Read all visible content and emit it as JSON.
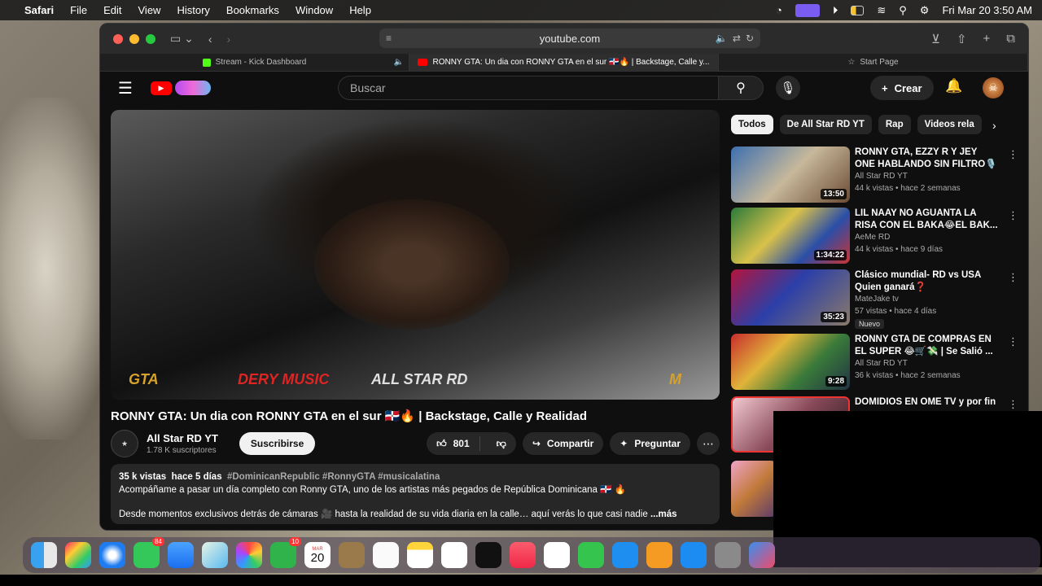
{
  "menubar": {
    "app": "Safari",
    "items": [
      "File",
      "Edit",
      "View",
      "History",
      "Bookmarks",
      "Window",
      "Help"
    ],
    "clock": "Fri Mar 20  3:50 AM"
  },
  "browser": {
    "url": "youtube.com",
    "tabs": [
      {
        "label": "Stream - Kick Dashboard"
      },
      {
        "label": "RONNY GTA: Un dia con RONNY GTA en el sur 🇩🇴🔥 | Backstage, Calle y..."
      },
      {
        "label": "Start Page"
      }
    ]
  },
  "youtube": {
    "search_placeholder": "Buscar",
    "create_label": "Crear",
    "video": {
      "title": "RONNY GTA: Un dia con RONNY GTA en el sur 🇩🇴🔥 | Backstage, Calle y Realidad",
      "watermarks": [
        "GTA",
        "DERY MUSIC",
        "ALL STAR RD",
        "M"
      ],
      "channel": "All Star RD YT",
      "subscribers": "1.78 K suscriptores",
      "subscribe_label": "Suscribirse",
      "likes": "801",
      "share_label": "Compartir",
      "ask_label": "Preguntar",
      "views": "35 k vistas",
      "age": "hace 5 días",
      "tags": "#DominicanRepublic #RonnyGTA #musicalatina",
      "desc_line1": "Acompáñame a pasar un día completo con Ronny GTA, uno de los artistas más pegados de República Dominicana 🇩🇴 🔥",
      "desc_line2": "Desde momentos exclusivos detrás de cámaras 🎥 hasta la realidad de su vida diaria en la calle… aquí verás lo que casi nadie",
      "more_label": "...más"
    },
    "chips": [
      "Todos",
      "De All Star RD YT",
      "Rap",
      "Videos rela"
    ],
    "recommendations": [
      {
        "title": "RONNY GTA, EZZY R Y JEY ONE HABLANDO SIN FILTRO🎙️",
        "channel": "All Star RD YT",
        "meta": "44 k vistas • hace 2 semanas",
        "duration": "13:50",
        "badge": ""
      },
      {
        "title": "LIL NAAY NO AGUANTA LA RISA CON EL BAKA😂EL BAK...",
        "channel": "AeMe RD",
        "meta": "44 k vistas • hace 9 días",
        "duration": "1:34:22",
        "badge": ""
      },
      {
        "title": "Clásico mundial- RD vs USA Quien ganará❓",
        "channel": "MateJake tv",
        "meta": "57 vistas • hace 4 días",
        "duration": "35:23",
        "badge": "Nuevo"
      },
      {
        "title": "RONNY GTA DE COMPRAS EN EL SUPER 😂🛒💸 | Se Salió ...",
        "channel": "All Star RD YT",
        "meta": "36 k vistas • hace 2 semanas",
        "duration": "9:28",
        "badge": ""
      },
      {
        "title": "DOMIDIOS EN OME TV y por fin",
        "channel": "",
        "meta": "",
        "duration": "",
        "badge": ""
      }
    ]
  },
  "dock": {
    "badges": {
      "messages": "84",
      "facetime": "10"
    },
    "calendar_month": "MAR",
    "calendar_day": "20"
  }
}
